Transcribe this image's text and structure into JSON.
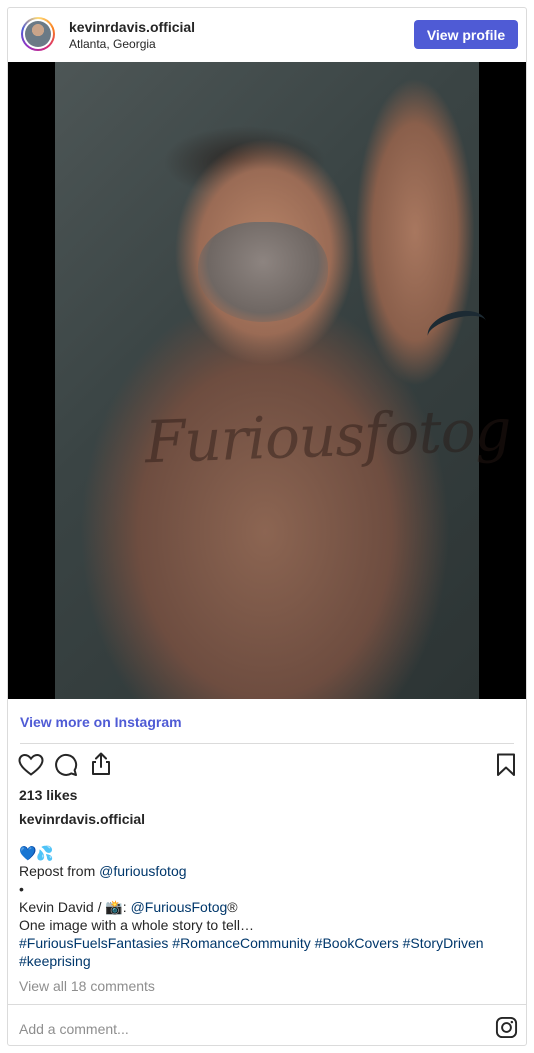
{
  "header": {
    "username": "kevinrdavis.official",
    "location": "Atlanta, Georgia",
    "view_profile_label": "View profile"
  },
  "media": {
    "watermark": "Furiousfotog"
  },
  "view_more_label": "View more on Instagram",
  "actions": {
    "icons": [
      "heart-icon",
      "comment-icon",
      "share-icon",
      "bookmark-icon"
    ]
  },
  "likes": "213 likes",
  "caption": {
    "username": "kevinrdavis.official",
    "emoji": "💙💦",
    "repost_prefix": "Repost from ",
    "repost_handle": "@furiousfotog",
    "bullet": "•",
    "credit_prefix": "Kevin David / 📸: ",
    "credit_handle": "@FuriousFotog",
    "credit_suffix": "®",
    "text": "One image with a whole story to tell…",
    "hashtags_line1": "#FuriousFuelsFantasies #RomanceCommunity #BookCovers #StoryDriven",
    "hashtags_line2": "#keeprising"
  },
  "view_comments_label": "View all 18 comments",
  "add_comment_placeholder": "Add a comment...",
  "colors": {
    "accent": "#4f5bd5",
    "link": "#00376b",
    "muted": "#8e8e8e"
  }
}
